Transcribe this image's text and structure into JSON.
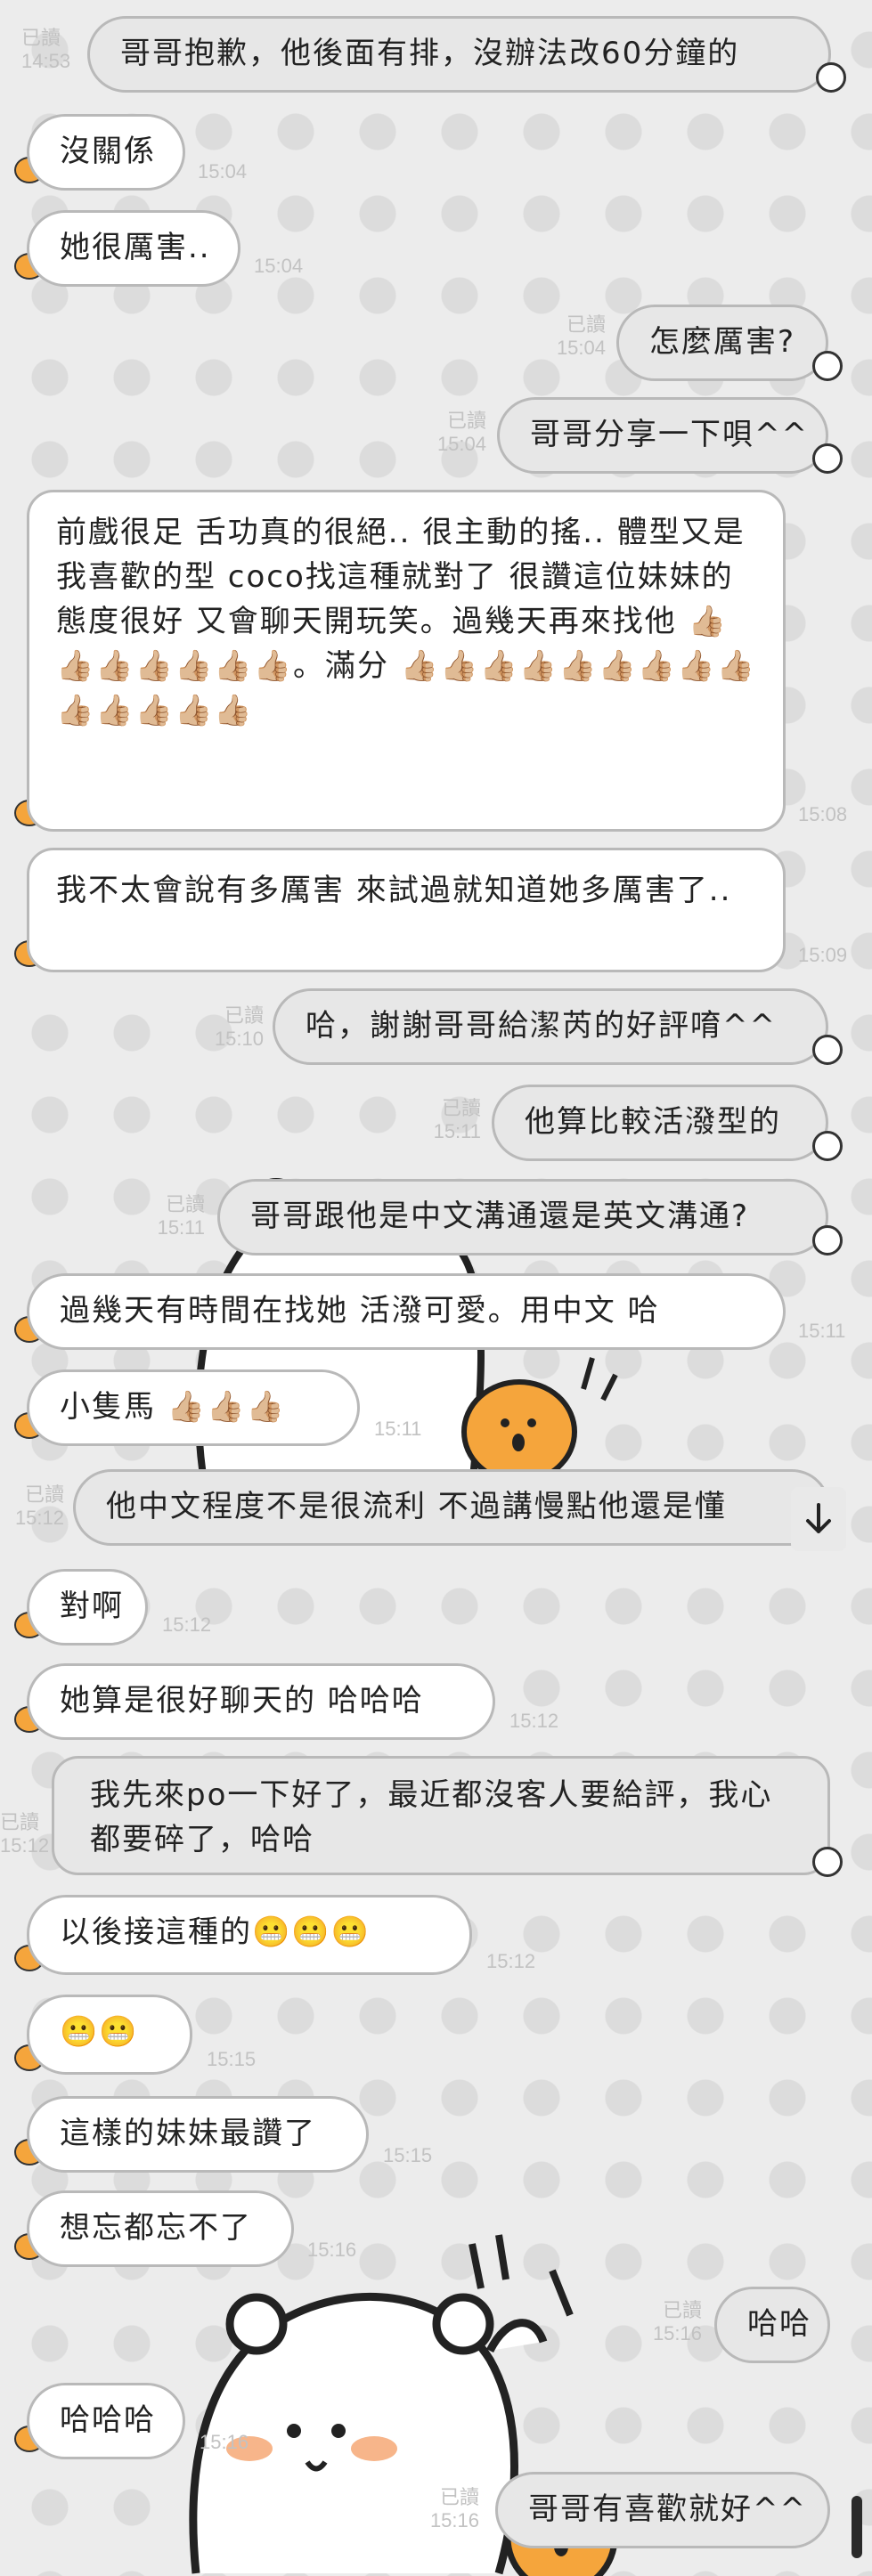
{
  "messages": [
    {
      "text": "哥哥抱歉，他後面有排，沒辦法改60分鐘的",
      "read": "已讀",
      "time": "14:53"
    },
    {
      "text": "沒關係",
      "time": "15:04"
    },
    {
      "text": "她很厲害..",
      "time": "15:04"
    },
    {
      "text": "怎麼厲害?",
      "read": "已讀",
      "time": "15:04"
    },
    {
      "text": "哥哥分享一下唄^^",
      "read": "已讀",
      "time": "15:04"
    },
    {
      "text": "前戲很足 舌功真的很絕.. 很主動的搖.. 體型又是我喜歡的型 coco找這種就對了 很讚這位妹妹的態度很好 又會聊天開玩笑。過幾天再來找他 👍🏼👍🏼👍🏼👍🏼👍🏼👍🏼👍🏼。滿分 👍🏼👍🏼👍🏼👍🏼👍🏼👍🏼👍🏼👍🏼👍🏼👍🏼👍🏼👍🏼👍🏼👍🏼",
      "time": "15:08"
    },
    {
      "text": "我不太會說有多厲害 來試過就知道她多厲害了..",
      "time": "15:09"
    },
    {
      "text": "哈，謝謝哥哥給潔芮的好評唷^^",
      "read": "已讀",
      "time": "15:10"
    },
    {
      "text": "他算比較活潑型的",
      "read": "已讀",
      "time": "15:11"
    },
    {
      "text": "哥哥跟他是中文溝通還是英文溝通?",
      "read": "已讀",
      "time": "15:11"
    },
    {
      "text": "過幾天有時間在找她 活潑可愛。用中文 哈",
      "time": "15:11"
    },
    {
      "text": "小隻馬 👍🏼👍🏼👍🏼",
      "time": "15:11"
    },
    {
      "text": "他中文程度不是很流利 不過講慢點他還是懂",
      "read": "已讀",
      "time": "15:12"
    },
    {
      "text": "對啊",
      "time": "15:12"
    },
    {
      "text": "她算是很好聊天的 哈哈哈",
      "time": "15:12"
    },
    {
      "text": "我先來po一下好了，最近都沒客人要給評，我心都要碎了，哈哈",
      "read": "已讀",
      "time": "15:12"
    },
    {
      "text": "以後接這種的😬😬😬",
      "time": "15:12"
    },
    {
      "text": "😬😬",
      "time": "15:15"
    },
    {
      "text": "這樣的妹妹最讚了",
      "time": "15:15"
    },
    {
      "text": "想忘都忘不了",
      "time": "15:16"
    },
    {
      "text": "哈哈",
      "read": "已讀",
      "time": "15:16"
    },
    {
      "text": "哈哈哈",
      "time": "15:16"
    },
    {
      "text": "哥哥有喜歡就好^^",
      "read": "已讀",
      "time": "15:16"
    }
  ],
  "icons": {
    "scroll_down": "arrow-down-icon"
  },
  "colors": {
    "avatar": "#f5a53c",
    "bubble_out": "#e7e7e7",
    "bubble_in": "#ffffff",
    "meta": "#c2c2c2"
  }
}
